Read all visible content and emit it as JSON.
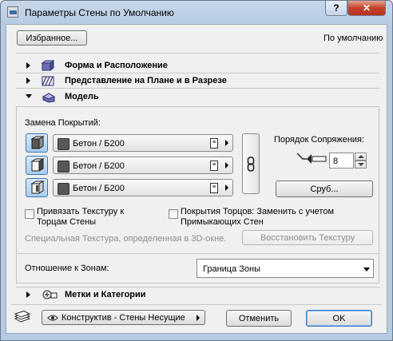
{
  "window": {
    "title": "Параметры Стены по Умолчанию",
    "help_label": "?",
    "close_label": "✕"
  },
  "top": {
    "favorites_label": "Избранное...",
    "default_label": "По умолчанию"
  },
  "sections": [
    {
      "label": "Форма и Расположение",
      "expanded": false,
      "icon": "shape-position-icon"
    },
    {
      "label": "Представление на Плане и в Разрезе",
      "expanded": false,
      "icon": "floor-plan-section-icon"
    },
    {
      "label": "Модель",
      "expanded": true,
      "icon": "model-icon"
    },
    {
      "label": "Метки и Категории",
      "expanded": false,
      "icon": "labels-categories-icon"
    }
  ],
  "model": {
    "surfaces_label": "Замена Покрытий:",
    "surfaces": [
      {
        "icon": "wall-outer-side-icon",
        "material": "Бетон / Б200"
      },
      {
        "icon": "wall-edge-side-icon",
        "material": "Бетон / Б200"
      },
      {
        "icon": "wall-inner-side-icon",
        "material": "Бетон / Б200"
      }
    ],
    "chain_icon": "chain-link-icon",
    "junction_label": "Порядок Сопряжения:",
    "junction_value": "8",
    "log_button_label": "Сруб...",
    "bind_texture_label": "Привязать Текстуру к Торцам Стены",
    "bind_texture_checked": false,
    "edge_cover_label": "Покрытия Торцов: Заменить с учетом Примыкающих Стен",
    "edge_cover_checked": false,
    "special_texture_label": "Специальная Текстура, определенная в 3D-окне.",
    "restore_texture_label": "Восстановить Текстуру",
    "zone_relation_label": "Отношение к Зонам:",
    "zone_relation_value": "Граница Зоны"
  },
  "footer": {
    "layer_value": "Конструктив - Стены Несущие",
    "cancel_label": "Отменить",
    "ok_label": "OK"
  },
  "colors": {
    "accent": "#3d76b0",
    "swatch": "#585858",
    "close": "#c4422a"
  }
}
